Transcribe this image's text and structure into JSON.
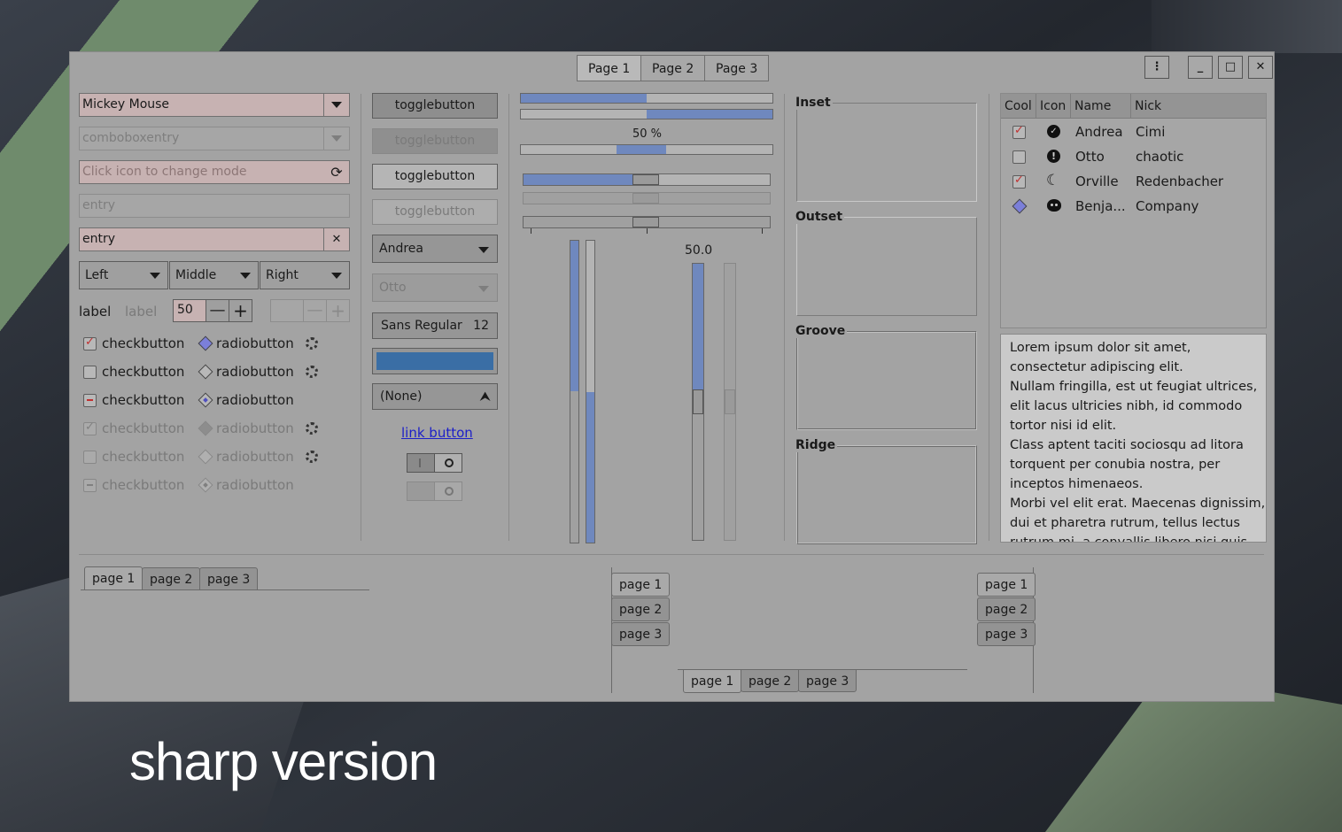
{
  "header": {
    "tabs": [
      "Page 1",
      "Page 2",
      "Page 3"
    ],
    "window_buttons": {
      "menu": "menu-dots-icon",
      "minimize": "minimize-icon",
      "maximize": "maximize-icon",
      "close": "close-icon"
    }
  },
  "left": {
    "combo_mickey": "Mickey Mouse",
    "combo_entry_placeholder": "comboboxentry",
    "icon_entry_placeholder": "Click icon to change mode",
    "entry_disabled": "entry",
    "entry_clearable": "entry",
    "combos": [
      "Left",
      "Middle",
      "Right"
    ],
    "label1": "label",
    "label2": "label",
    "spin_value": "50",
    "checks": [
      "checkbutton",
      "checkbutton",
      "checkbutton",
      "checkbutton",
      "checkbutton",
      "checkbutton"
    ],
    "radios": [
      "radiobutton",
      "radiobutton",
      "radiobutton",
      "radiobutton",
      "radiobutton",
      "radiobutton"
    ]
  },
  "middle": {
    "toggle": [
      "togglebutton",
      "togglebutton",
      "togglebutton",
      "togglebutton"
    ],
    "combo_andrea": "Andrea",
    "combo_otto": "Otto",
    "font_name": "Sans Regular",
    "font_size": "12",
    "color_hex": "#3a6ea5",
    "file_none": "(None)",
    "link": "link button"
  },
  "scales": {
    "progress_label": "50 %",
    "vscale_label": "50.0",
    "progress1": 0.5,
    "progress2": 0.5,
    "progress3": 0.5,
    "hscale1": 0.45,
    "hscale2": 0.45,
    "hscale3": 0.45
  },
  "frames": [
    "Inset",
    "Outset",
    "Groove",
    "Ridge"
  ],
  "tree": {
    "headers": [
      "Cool",
      "Icon",
      "Name",
      "Nick"
    ],
    "rows": [
      {
        "cool": true,
        "icon": "check-circle-icon",
        "name": "Andrea",
        "nick": "Cimi"
      },
      {
        "cool": false,
        "icon": "exclamation-circle-icon",
        "name": "Otto",
        "nick": "chaotic"
      },
      {
        "cool": true,
        "icon": "moon-icon",
        "name": "Orville",
        "nick": "Redenbacher"
      },
      {
        "cool": null,
        "icon": "face-icon",
        "name": "Benja...",
        "nick": "Company"
      }
    ]
  },
  "textview": [
    "Lorem ipsum dolor sit amet,",
    "consectetur adipiscing elit.",
    "Nullam fringilla, est ut feugiat ultrices,",
    "elit lacus ultricies nibh, id commodo",
    "tortor nisi id elit.",
    "Class aptent taciti sociosqu ad litora",
    "torquent per conubia nostra, per",
    "inceptos himenaeos.",
    "Morbi vel elit erat. Maecenas dignissim,",
    "dui et pharetra rutrum, tellus lectus",
    "rutrum mi, a convallis libero nisi quis"
  ],
  "notebooks": {
    "tabs": [
      "page 1",
      "page 2",
      "page 3"
    ]
  },
  "caption": "sharp version",
  "colors": {
    "accent": "#6f88be",
    "entry_bg": "#c7b2b2",
    "window_bg": "#a3a3a3"
  }
}
